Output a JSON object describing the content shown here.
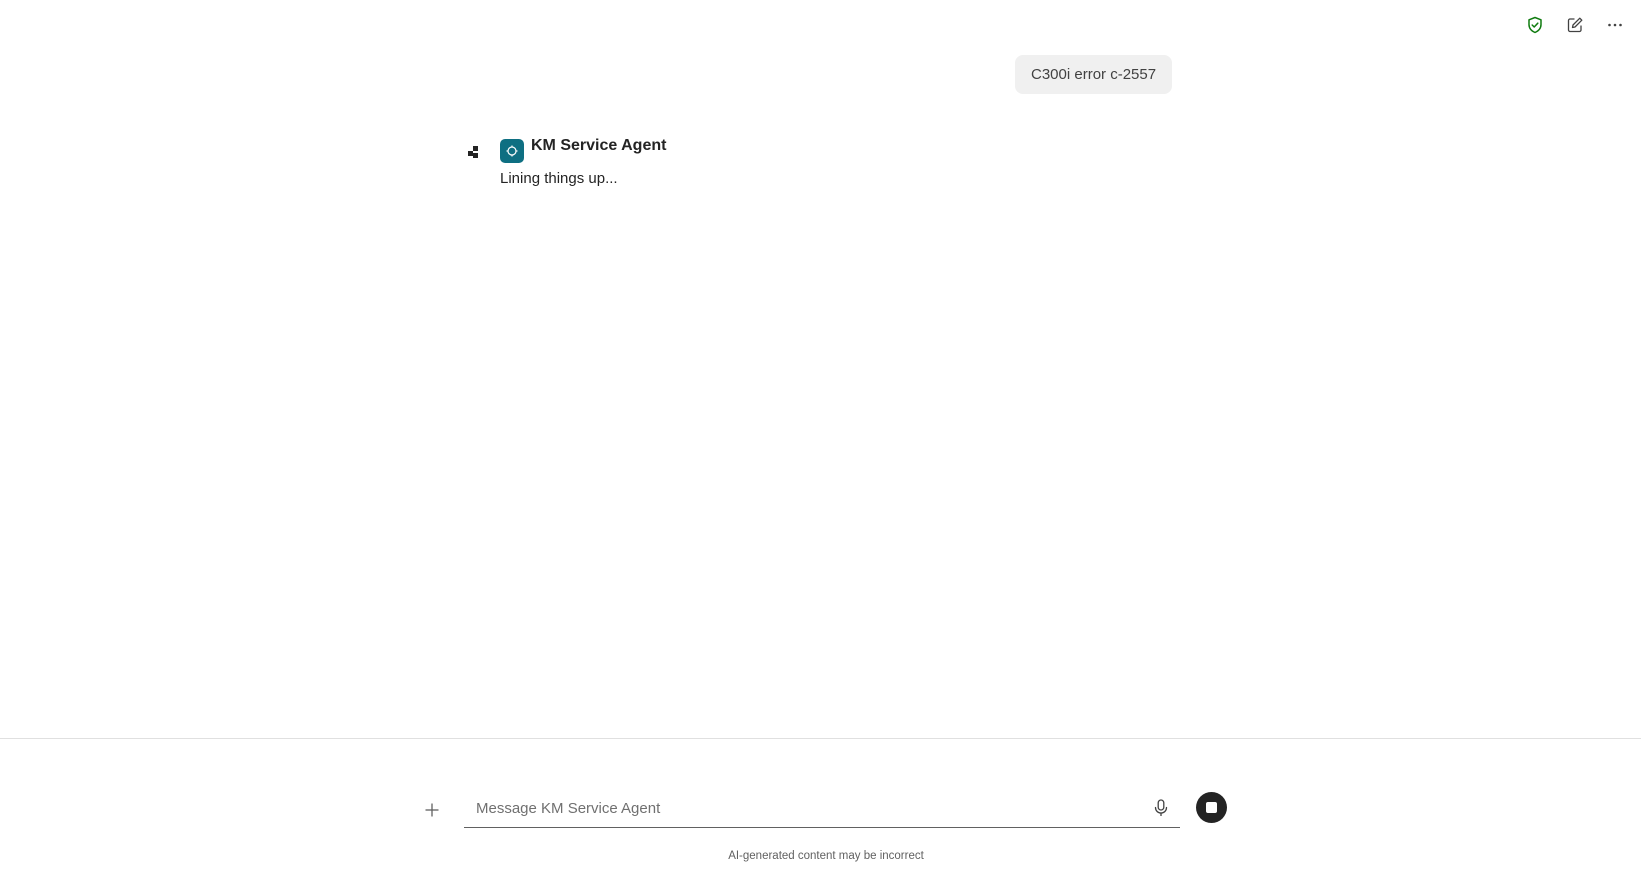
{
  "toolbar": {
    "icons": [
      "shield-check-icon",
      "compose-icon",
      "more-icon"
    ],
    "accent_color": "#107c10"
  },
  "conversation": {
    "user_message": "C300i error c-2557",
    "agent": {
      "name": "KM Service Agent",
      "status_text": "Lining things up...",
      "avatar_color": "#0e6f82"
    }
  },
  "composer": {
    "placeholder": "Message KM Service Agent",
    "value": ""
  },
  "footer": {
    "disclaimer": "AI-generated content may be incorrect"
  }
}
